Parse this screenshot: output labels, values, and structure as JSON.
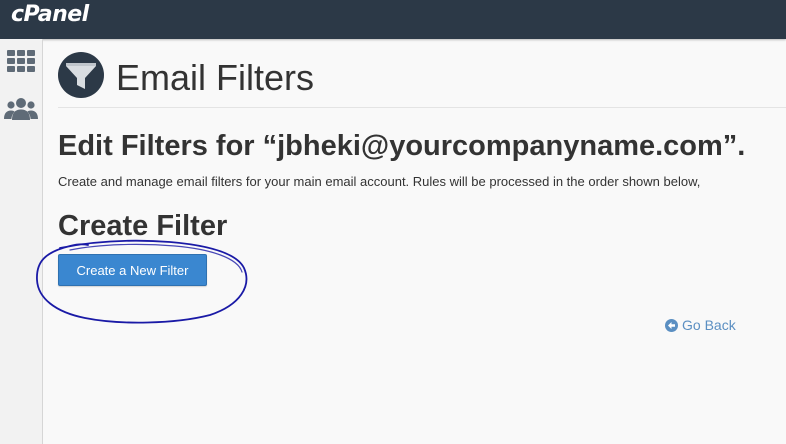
{
  "header": {
    "logo_text": "cPanel"
  },
  "sidebar": {
    "items": [
      {
        "icon": "grid-icon",
        "label": ""
      },
      {
        "icon": "users-icon",
        "label": ""
      }
    ]
  },
  "page": {
    "title": "Email Filters",
    "title_icon": "funnel-icon",
    "subheading": "Edit Filters for “jbheki@yourcompanyname.com”.",
    "description": "Create and manage email filters for your main email account. Rules will be processed in the order shown below,",
    "section_heading": "Create Filter",
    "create_button_label": "Create a New Filter",
    "go_back_label": "Go Back"
  },
  "colors": {
    "topbar": "#2c3947",
    "button": "#3a87d0",
    "link": "#5b8fc2",
    "annotation_ink": "#1a1aa6"
  }
}
